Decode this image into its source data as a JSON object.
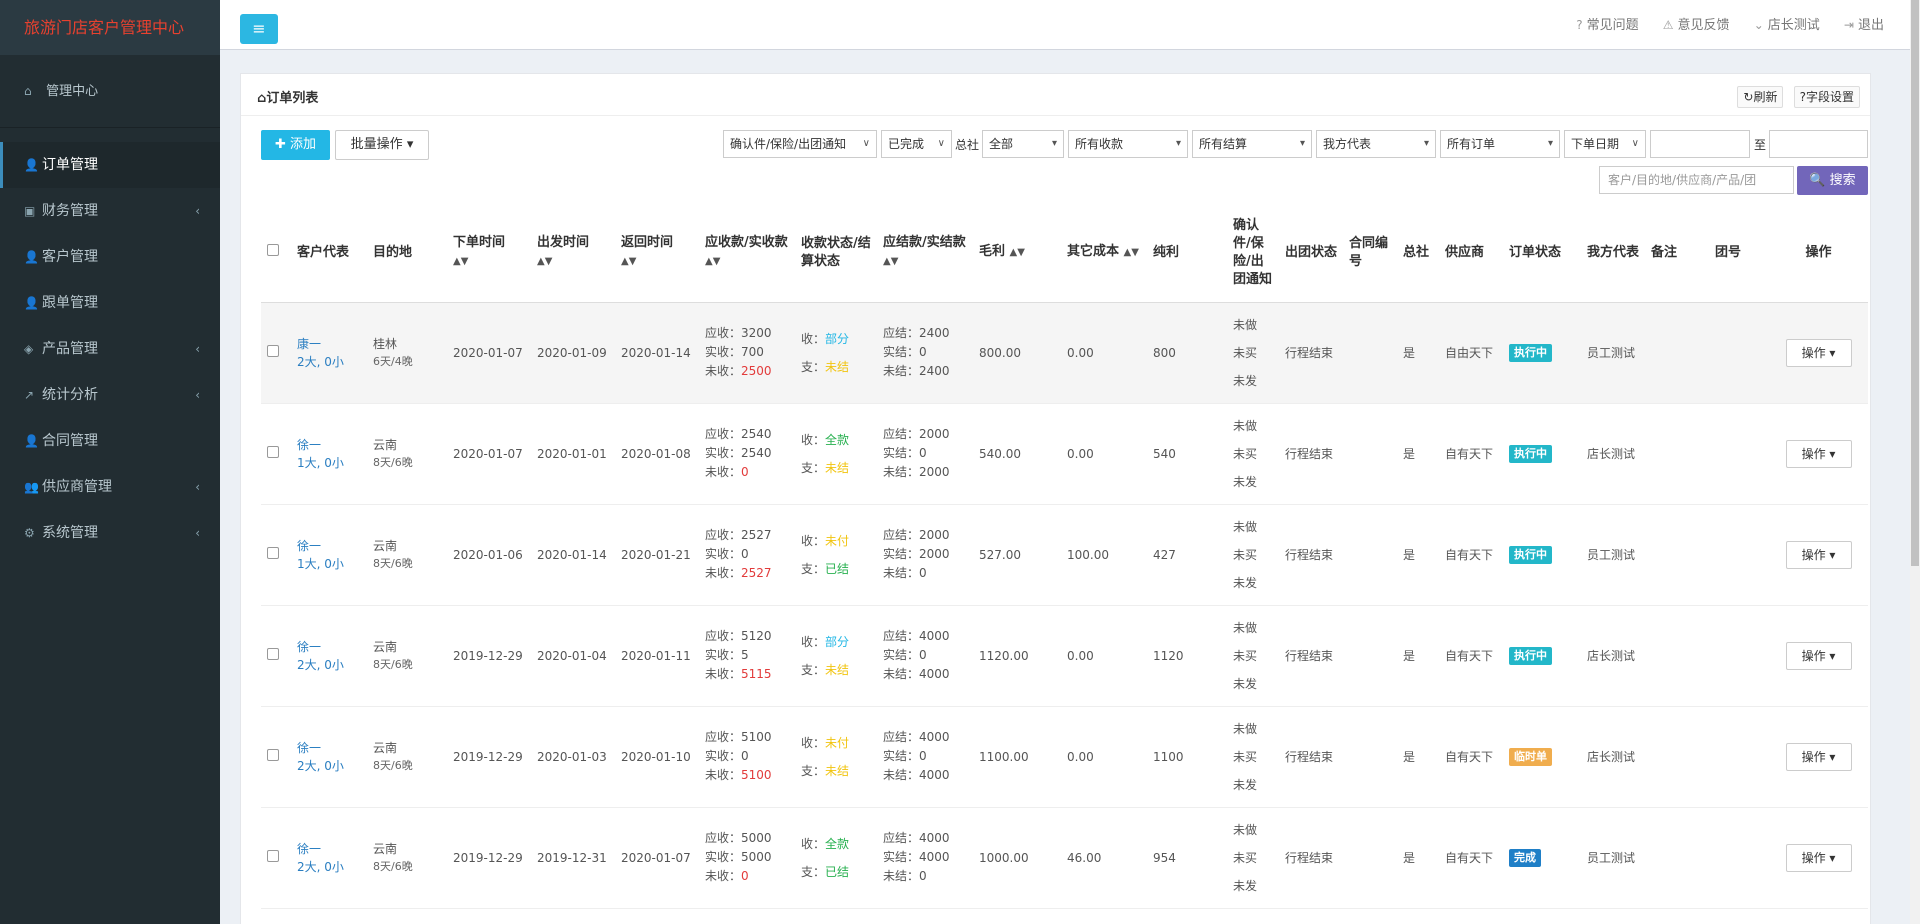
{
  "app": {
    "brand": "旅游门店客户管理中心"
  },
  "sidebar": {
    "home": "管理中心",
    "items": [
      {
        "label": "订单管理",
        "icon": "user-icon",
        "glyph": "👤",
        "caret": false,
        "active": true
      },
      {
        "label": "财务管理",
        "icon": "money-icon",
        "glyph": "▣",
        "caret": true
      },
      {
        "label": "客户管理",
        "icon": "user-icon",
        "glyph": "👤",
        "caret": false
      },
      {
        "label": "跟单管理",
        "icon": "user-icon",
        "glyph": "👤",
        "caret": false
      },
      {
        "label": "产品管理",
        "icon": "cube-icon",
        "glyph": "◈",
        "caret": true
      },
      {
        "label": "统计分析",
        "icon": "chart-icon",
        "glyph": "↗",
        "caret": true
      },
      {
        "label": "合同管理",
        "icon": "user-icon",
        "glyph": "👤",
        "caret": false
      },
      {
        "label": "供应商管理",
        "icon": "users-icon",
        "glyph": "👥",
        "caret": true
      },
      {
        "label": "系统管理",
        "icon": "cogs-icon",
        "glyph": "⚙",
        "caret": true
      }
    ]
  },
  "topbar": {
    "faq": "常见问题",
    "feedback": "意见反馈",
    "user": "店长测试",
    "logout": "退出"
  },
  "panel": {
    "title": "订单列表",
    "refresh": "刷新",
    "field_settings": "字段设置"
  },
  "toolbar": {
    "add": "添加",
    "batch": "批量操作",
    "filter_notice": "确认件/保险/出团通知",
    "filter_status": "已完成",
    "label_hq": "总社",
    "filter_hq": "全部",
    "filter_income": "所有收款",
    "filter_settle": "所有结算",
    "filter_rep": "我方代表",
    "filter_orders": "所有订单",
    "filter_date": "下单日期",
    "label_to": "至",
    "search_placeholder": "客户/目的地/供应商/产品/团",
    "search": "搜索"
  },
  "columns": {
    "rep": "客户代表",
    "dest": "目的地",
    "order_time": "下单时间",
    "depart_time": "出发时间",
    "return_time": "返回时间",
    "receivable": "应收款/实收款",
    "pay_status": "收款状态/结算状态",
    "payable": "应结款/实结款",
    "gross": "毛利",
    "other_cost": "其它成本",
    "net": "纯利",
    "confirm": "确认件/保险/出团通知",
    "tour_status": "出团状态",
    "contract": "合同编号",
    "hq": "总社",
    "supplier": "供应商",
    "order_status": "订单状态",
    "our_rep": "我方代表",
    "note": "备注",
    "group_no": "团号",
    "action": "操作"
  },
  "rows": [
    {
      "name": "康一",
      "people": "2大, 0小",
      "dest": "桂林",
      "days": "6天/4晚",
      "order": "2020-01-07",
      "depart": "2020-01-09",
      "ret": "2020-01-14",
      "recv": "应收：3200",
      "paid": "实收：700",
      "unpaid": "未收：",
      "unpaid_val": "2500",
      "in_label": "收：",
      "in_status": "部分",
      "in_color": "cyan",
      "out_label": "支：",
      "out_status": "未结",
      "out_color": "yellow",
      "pay_due": "应结：2400",
      "pay_done": "实结：0",
      "pay_left": "未结：2400",
      "gross": "800.00",
      "other": "0.00",
      "net": "800",
      "c1": "未做",
      "c2": "未买",
      "c3": "未发",
      "tour": "行程结束",
      "contract": "",
      "hq": "是",
      "supplier": "自由天下",
      "status": "执行中",
      "status_color": "#23b7c9",
      "our_rep": "员工测试",
      "note": "",
      "group": "",
      "action": "操作",
      "hl": true
    },
    {
      "name": "徐一",
      "people": "1大, 0小",
      "dest": "云南",
      "days": "8天/6晚",
      "order": "2020-01-07",
      "depart": "2020-01-01",
      "ret": "2020-01-08",
      "recv": "应收：2540",
      "paid": "实收：2540",
      "unpaid": "未收：",
      "unpaid_val": "0",
      "in_label": "收：",
      "in_status": "全款",
      "in_color": "green",
      "out_label": "支：",
      "out_status": "未结",
      "out_color": "yellow",
      "pay_due": "应结：2000",
      "pay_done": "实结：0",
      "pay_left": "未结：2000",
      "gross": "540.00",
      "other": "0.00",
      "net": "540",
      "c1": "未做",
      "c2": "未买",
      "c3": "未发",
      "tour": "行程结束",
      "contract": "",
      "hq": "是",
      "supplier": "自有天下",
      "status": "执行中",
      "status_color": "#23b7c9",
      "our_rep": "店长测试",
      "note": "",
      "group": "",
      "action": "操作",
      "hl": false
    },
    {
      "name": "徐一",
      "people": "1大, 0小",
      "dest": "云南",
      "days": "8天/6晚",
      "order": "2020-01-06",
      "depart": "2020-01-14",
      "ret": "2020-01-21",
      "recv": "应收：2527",
      "paid": "实收：0",
      "unpaid": "未收：",
      "unpaid_val": "2527",
      "in_label": "收：",
      "in_status": "未付",
      "in_color": "yellow",
      "out_label": "支：",
      "out_status": "已结",
      "out_color": "green",
      "pay_due": "应结：2000",
      "pay_done": "实结：2000",
      "pay_left": "未结：0",
      "gross": "527.00",
      "other": "100.00",
      "net": "427",
      "c1": "未做",
      "c2": "未买",
      "c3": "未发",
      "tour": "行程结束",
      "contract": "",
      "hq": "是",
      "supplier": "自有天下",
      "status": "执行中",
      "status_color": "#23b7c9",
      "our_rep": "员工测试",
      "note": "",
      "group": "",
      "action": "操作",
      "hl": false
    },
    {
      "name": "徐一",
      "people": "2大, 0小",
      "dest": "云南",
      "days": "8天/6晚",
      "order": "2019-12-29",
      "depart": "2020-01-04",
      "ret": "2020-01-11",
      "recv": "应收：5120",
      "paid": "实收：5",
      "unpaid": "未收：",
      "unpaid_val": "5115",
      "in_label": "收：",
      "in_status": "部分",
      "in_color": "cyan",
      "out_label": "支：",
      "out_status": "未结",
      "out_color": "yellow",
      "pay_due": "应结：4000",
      "pay_done": "实结：0",
      "pay_left": "未结：4000",
      "gross": "1120.00",
      "other": "0.00",
      "net": "1120",
      "c1": "未做",
      "c2": "未买",
      "c3": "未发",
      "tour": "行程结束",
      "contract": "",
      "hq": "是",
      "supplier": "自有天下",
      "status": "执行中",
      "status_color": "#23b7c9",
      "our_rep": "店长测试",
      "note": "",
      "group": "",
      "action": "操作",
      "hl": false
    },
    {
      "name": "徐一",
      "people": "2大, 0小",
      "dest": "云南",
      "days": "8天/6晚",
      "order": "2019-12-29",
      "depart": "2020-01-03",
      "ret": "2020-01-10",
      "recv": "应收：5100",
      "paid": "实收：0",
      "unpaid": "未收：",
      "unpaid_val": "5100",
      "in_label": "收：",
      "in_status": "未付",
      "in_color": "yellow",
      "out_label": "支：",
      "out_status": "未结",
      "out_color": "yellow",
      "pay_due": "应结：4000",
      "pay_done": "实结：0",
      "pay_left": "未结：4000",
      "gross": "1100.00",
      "other": "0.00",
      "net": "1100",
      "c1": "未做",
      "c2": "未买",
      "c3": "未发",
      "tour": "行程结束",
      "contract": "",
      "hq": "是",
      "supplier": "自有天下",
      "status": "临时单",
      "status_color": "#f0ad4e",
      "our_rep": "店长测试",
      "note": "",
      "group": "",
      "action": "操作",
      "hl": false
    },
    {
      "name": "徐一",
      "people": "2大, 0小",
      "dest": "云南",
      "days": "8天/6晚",
      "order": "2019-12-29",
      "depart": "2019-12-31",
      "ret": "2020-01-07",
      "recv": "应收：5000",
      "paid": "实收：5000",
      "unpaid": "未收：",
      "unpaid_val": "0",
      "in_label": "收：",
      "in_status": "全款",
      "in_color": "green",
      "out_label": "支：",
      "out_status": "已结",
      "out_color": "green",
      "pay_due": "应结：4000",
      "pay_done": "实结：4000",
      "pay_left": "未结：0",
      "gross": "1000.00",
      "other": "46.00",
      "net": "954",
      "c1": "未做",
      "c2": "未买",
      "c3": "未发",
      "tour": "行程结束",
      "contract": "",
      "hq": "是",
      "supplier": "自有天下",
      "status": "完成",
      "status_color": "#1f7fc7",
      "our_rep": "员工测试",
      "note": "",
      "group": "",
      "action": "操作",
      "hl": false
    }
  ]
}
